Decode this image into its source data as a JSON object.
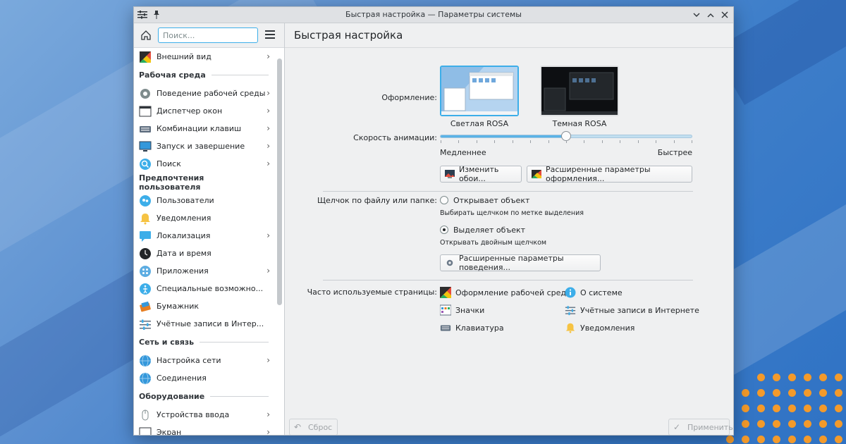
{
  "window": {
    "title": "Быстрая настройка — Параметры системы"
  },
  "sidebar": {
    "search_placeholder": "Поиск...",
    "top_item": {
      "label": "Внешний вид"
    },
    "categories": [
      {
        "title": "Рабочая среда",
        "items": [
          {
            "label": "Поведение рабочей среды",
            "icon": "gear-icon",
            "chevron": true
          },
          {
            "label": "Диспетчер окон",
            "icon": "window-icon",
            "chevron": true
          },
          {
            "label": "Комбинации клавиш",
            "icon": "keyboard-icon",
            "chevron": true
          },
          {
            "label": "Запуск и завершение",
            "icon": "monitor-icon",
            "chevron": true
          },
          {
            "label": "Поиск",
            "icon": "search-icon",
            "chevron": true
          }
        ]
      },
      {
        "title": "Предпочтения пользователя",
        "items": [
          {
            "label": "Пользователи",
            "icon": "users-icon",
            "chevron": false
          },
          {
            "label": "Уведомления",
            "icon": "bell-icon",
            "chevron": false
          },
          {
            "label": "Локализация",
            "icon": "chat-icon",
            "chevron": true
          },
          {
            "label": "Дата и время",
            "icon": "clock-icon",
            "chevron": false
          },
          {
            "label": "Приложения",
            "icon": "apps-icon",
            "chevron": true
          },
          {
            "label": "Специальные возможно...",
            "icon": "accessibility-icon",
            "chevron": false
          },
          {
            "label": "Бумажник",
            "icon": "wallet-icon",
            "chevron": false
          },
          {
            "label": "Учётные записи в Интер...",
            "icon": "sliders-icon",
            "chevron": false
          }
        ]
      },
      {
        "title": "Сеть и связь",
        "items": [
          {
            "label": "Настройка сети",
            "icon": "globe-icon",
            "chevron": true
          },
          {
            "label": "Соединения",
            "icon": "globe-icon",
            "chevron": false
          }
        ]
      },
      {
        "title": "Оборудование",
        "items": [
          {
            "label": "Устройства ввода",
            "icon": "mouse-icon",
            "chevron": true
          },
          {
            "label": "Экран",
            "icon": "display-icon",
            "chevron": true
          }
        ]
      }
    ]
  },
  "main": {
    "heading": "Быстрая настройка",
    "theme_label": "Оформление:",
    "themes": [
      {
        "caption": "Светлая ROSA",
        "selected": true
      },
      {
        "caption": "Темная ROSA",
        "selected": false
      }
    ],
    "anim_label": "Скорость анимации:",
    "anim_slow": "Медленнее",
    "anim_fast": "Быстрее",
    "anim_level": 0.5,
    "btn_wallpaper": "Изменить обои...",
    "btn_appearance": "Расширенные параметры оформления...",
    "click_label": "Щелчок по файлу или папке:",
    "opt_open": "Открывает объект",
    "opt_open_hint": "Выбирать щелчком по метке выделения",
    "opt_select": "Выделяет объект",
    "opt_select_hint": "Открывать двойным щелчком",
    "btn_behavior": "Расширенные параметры поведения...",
    "frequent_label": "Часто используемые страницы:",
    "frequent": [
      {
        "label": "Оформление рабочей среды",
        "icon": "palette-icon"
      },
      {
        "label": "О системе",
        "icon": "info-icon"
      },
      {
        "label": "Значки",
        "icon": "icons-icon"
      },
      {
        "label": "Учётные записи в Интернете",
        "icon": "sliders-icon"
      },
      {
        "label": "Клавиатура",
        "icon": "keyboard-icon"
      },
      {
        "label": "Уведомления",
        "icon": "bell-icon"
      }
    ],
    "btn_reset": "Сброс",
    "btn_apply": "Применить"
  }
}
